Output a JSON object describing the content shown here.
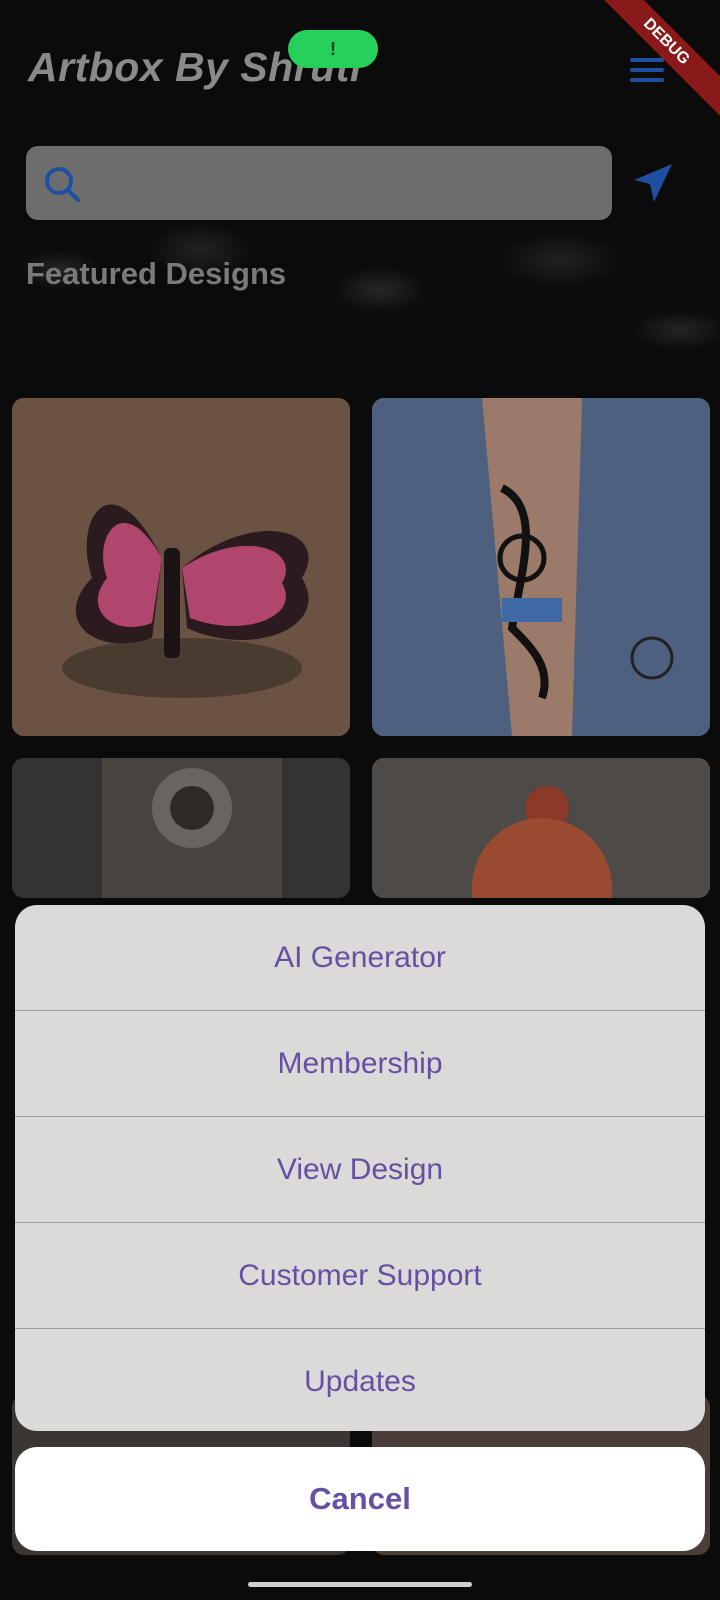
{
  "app": {
    "title": "Artbox By Shruti"
  },
  "status": {
    "camera_indicator": "!",
    "debug_banner": "DEBUG"
  },
  "search": {
    "placeholder": ""
  },
  "section": {
    "title": "Featured Designs"
  },
  "action_sheet": {
    "items": [
      {
        "label": "AI Generator"
      },
      {
        "label": "Membership"
      },
      {
        "label": "View Design"
      },
      {
        "label": "Customer Support"
      },
      {
        "label": "Updates"
      }
    ],
    "cancel_label": "Cancel"
  },
  "colors": {
    "accent": "#6650a4",
    "icon_blue": "#1f4fa0",
    "title_grey": "#8a8a8a"
  },
  "icons": {
    "menu": "hamburger-icon",
    "search": "search-icon",
    "send": "send-icon"
  }
}
